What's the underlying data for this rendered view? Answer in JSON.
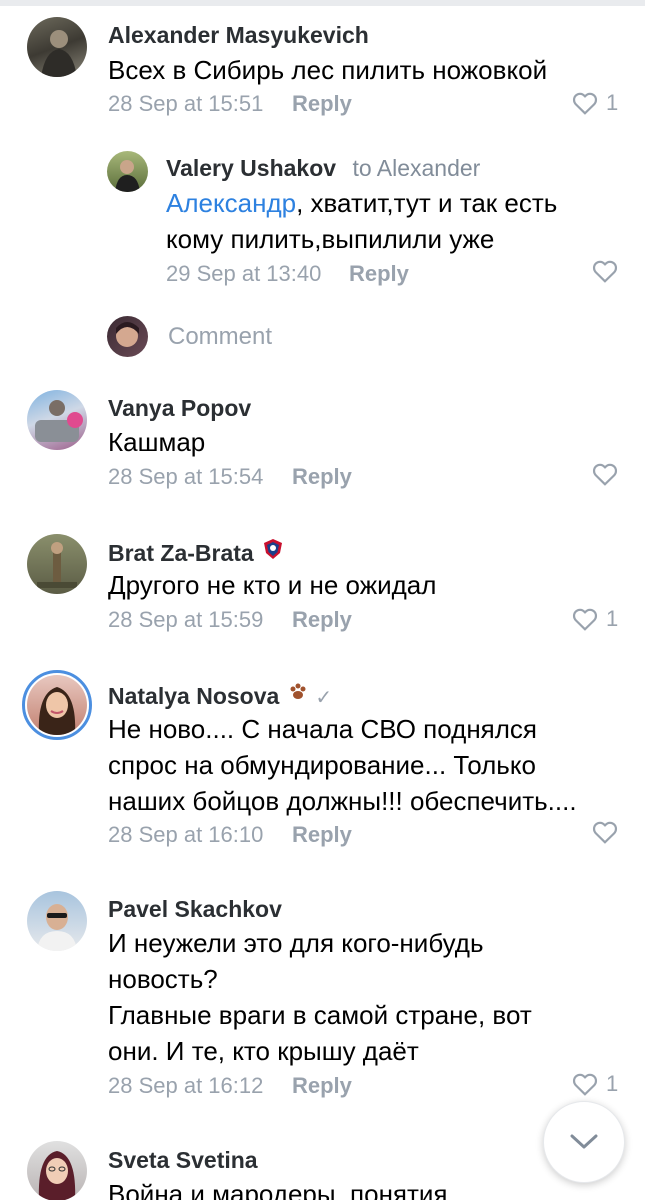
{
  "comments": [
    {
      "author": "Alexander Masyukevich",
      "text": "Всех в Сибирь лес пилить ножовкой",
      "time": "28 Sep at 15:51",
      "reply": "Reply",
      "likes": "1"
    },
    {
      "author": "Valery Ushakov",
      "to": "to Alexander",
      "mention": "Александр",
      "text_line1": ", хватит,тут и так есть",
      "text_line2": "кому пилить,выпилили уже",
      "time": "29 Sep at 13:40",
      "reply": "Reply"
    },
    {
      "author": "Vanya Popov",
      "text": "Кашмар",
      "time": "28 Sep at 15:54",
      "reply": "Reply"
    },
    {
      "author": "Brat Za-Brata",
      "text": "Другого не кто и не ожидал",
      "time": "28 Sep at 15:59",
      "reply": "Reply",
      "likes": "1"
    },
    {
      "author": "Natalya Nosova",
      "text_lines": [
        "Не ново.... С начала СВО поднялся",
        "спрос на обмундирование... Только",
        "наших бойцов должны!!! обеспечить...."
      ],
      "time": "28 Sep at 16:10",
      "reply": "Reply"
    },
    {
      "author": "Pavel Skachkov",
      "text_lines": [
        "И неужели это для кого-нибудь",
        "новость?",
        "Главные враги в самой стране, вот",
        "они. И те, кто крышу даёт"
      ],
      "time": "28 Sep at 16:12",
      "reply": "Reply",
      "likes": "1"
    },
    {
      "author": "Sveta Svetina",
      "text": "Война и мародеры, понятия"
    }
  ],
  "comment_link": "Comment",
  "icons": {
    "like": "heart-outline-icon",
    "scroll_down": "chevron-down-icon",
    "verified": "checkmark-icon"
  },
  "colors": {
    "secondary": "#99a2ad",
    "mention": "#2d81e0",
    "author": "#2b2f33"
  }
}
